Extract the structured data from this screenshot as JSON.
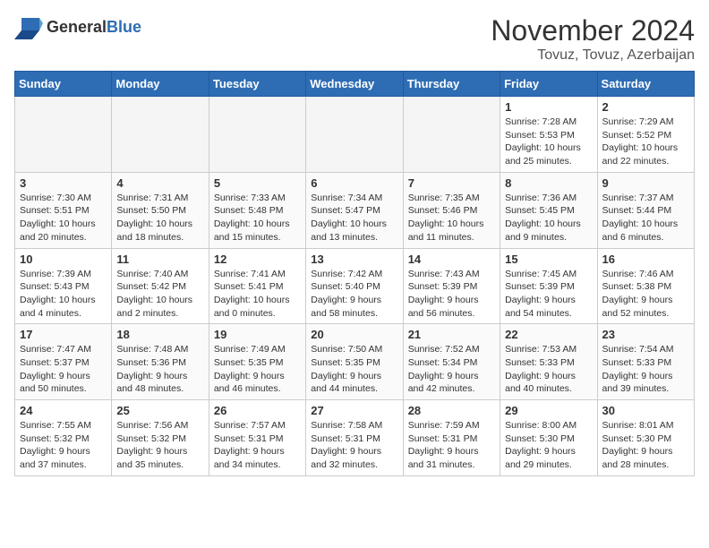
{
  "header": {
    "logo_general": "General",
    "logo_blue": "Blue",
    "month_title": "November 2024",
    "location": "Tovuz, Tovuz, Azerbaijan"
  },
  "weekdays": [
    "Sunday",
    "Monday",
    "Tuesday",
    "Wednesday",
    "Thursday",
    "Friday",
    "Saturday"
  ],
  "weeks": [
    [
      {
        "day": "",
        "info": ""
      },
      {
        "day": "",
        "info": ""
      },
      {
        "day": "",
        "info": ""
      },
      {
        "day": "",
        "info": ""
      },
      {
        "day": "",
        "info": ""
      },
      {
        "day": "1",
        "info": "Sunrise: 7:28 AM\nSunset: 5:53 PM\nDaylight: 10 hours\nand 25 minutes."
      },
      {
        "day": "2",
        "info": "Sunrise: 7:29 AM\nSunset: 5:52 PM\nDaylight: 10 hours\nand 22 minutes."
      }
    ],
    [
      {
        "day": "3",
        "info": "Sunrise: 7:30 AM\nSunset: 5:51 PM\nDaylight: 10 hours\nand 20 minutes."
      },
      {
        "day": "4",
        "info": "Sunrise: 7:31 AM\nSunset: 5:50 PM\nDaylight: 10 hours\nand 18 minutes."
      },
      {
        "day": "5",
        "info": "Sunrise: 7:33 AM\nSunset: 5:48 PM\nDaylight: 10 hours\nand 15 minutes."
      },
      {
        "day": "6",
        "info": "Sunrise: 7:34 AM\nSunset: 5:47 PM\nDaylight: 10 hours\nand 13 minutes."
      },
      {
        "day": "7",
        "info": "Sunrise: 7:35 AM\nSunset: 5:46 PM\nDaylight: 10 hours\nand 11 minutes."
      },
      {
        "day": "8",
        "info": "Sunrise: 7:36 AM\nSunset: 5:45 PM\nDaylight: 10 hours\nand 9 minutes."
      },
      {
        "day": "9",
        "info": "Sunrise: 7:37 AM\nSunset: 5:44 PM\nDaylight: 10 hours\nand 6 minutes."
      }
    ],
    [
      {
        "day": "10",
        "info": "Sunrise: 7:39 AM\nSunset: 5:43 PM\nDaylight: 10 hours\nand 4 minutes."
      },
      {
        "day": "11",
        "info": "Sunrise: 7:40 AM\nSunset: 5:42 PM\nDaylight: 10 hours\nand 2 minutes."
      },
      {
        "day": "12",
        "info": "Sunrise: 7:41 AM\nSunset: 5:41 PM\nDaylight: 10 hours\nand 0 minutes."
      },
      {
        "day": "13",
        "info": "Sunrise: 7:42 AM\nSunset: 5:40 PM\nDaylight: 9 hours\nand 58 minutes."
      },
      {
        "day": "14",
        "info": "Sunrise: 7:43 AM\nSunset: 5:39 PM\nDaylight: 9 hours\nand 56 minutes."
      },
      {
        "day": "15",
        "info": "Sunrise: 7:45 AM\nSunset: 5:39 PM\nDaylight: 9 hours\nand 54 minutes."
      },
      {
        "day": "16",
        "info": "Sunrise: 7:46 AM\nSunset: 5:38 PM\nDaylight: 9 hours\nand 52 minutes."
      }
    ],
    [
      {
        "day": "17",
        "info": "Sunrise: 7:47 AM\nSunset: 5:37 PM\nDaylight: 9 hours\nand 50 minutes."
      },
      {
        "day": "18",
        "info": "Sunrise: 7:48 AM\nSunset: 5:36 PM\nDaylight: 9 hours\nand 48 minutes."
      },
      {
        "day": "19",
        "info": "Sunrise: 7:49 AM\nSunset: 5:35 PM\nDaylight: 9 hours\nand 46 minutes."
      },
      {
        "day": "20",
        "info": "Sunrise: 7:50 AM\nSunset: 5:35 PM\nDaylight: 9 hours\nand 44 minutes."
      },
      {
        "day": "21",
        "info": "Sunrise: 7:52 AM\nSunset: 5:34 PM\nDaylight: 9 hours\nand 42 minutes."
      },
      {
        "day": "22",
        "info": "Sunrise: 7:53 AM\nSunset: 5:33 PM\nDaylight: 9 hours\nand 40 minutes."
      },
      {
        "day": "23",
        "info": "Sunrise: 7:54 AM\nSunset: 5:33 PM\nDaylight: 9 hours\nand 39 minutes."
      }
    ],
    [
      {
        "day": "24",
        "info": "Sunrise: 7:55 AM\nSunset: 5:32 PM\nDaylight: 9 hours\nand 37 minutes."
      },
      {
        "day": "25",
        "info": "Sunrise: 7:56 AM\nSunset: 5:32 PM\nDaylight: 9 hours\nand 35 minutes."
      },
      {
        "day": "26",
        "info": "Sunrise: 7:57 AM\nSunset: 5:31 PM\nDaylight: 9 hours\nand 34 minutes."
      },
      {
        "day": "27",
        "info": "Sunrise: 7:58 AM\nSunset: 5:31 PM\nDaylight: 9 hours\nand 32 minutes."
      },
      {
        "day": "28",
        "info": "Sunrise: 7:59 AM\nSunset: 5:31 PM\nDaylight: 9 hours\nand 31 minutes."
      },
      {
        "day": "29",
        "info": "Sunrise: 8:00 AM\nSunset: 5:30 PM\nDaylight: 9 hours\nand 29 minutes."
      },
      {
        "day": "30",
        "info": "Sunrise: 8:01 AM\nSunset: 5:30 PM\nDaylight: 9 hours\nand 28 minutes."
      }
    ]
  ]
}
